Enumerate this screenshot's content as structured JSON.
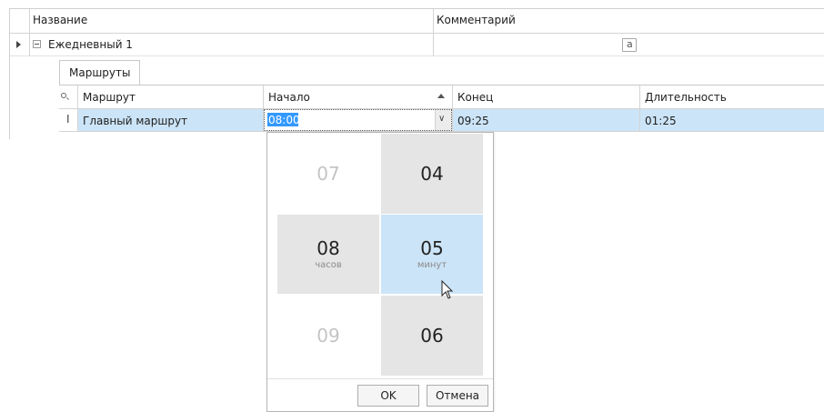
{
  "grid": {
    "columns": {
      "name": "Название",
      "comment": "Комментарий"
    },
    "group_row": {
      "name": "Ежедневный 1",
      "comment_icon": "a"
    }
  },
  "detail": {
    "tab": "Маршруты",
    "columns": {
      "route": "Маршрут",
      "start": "Начало",
      "end": "Конец",
      "duration": "Длительность"
    },
    "row": {
      "route": "Главный маршрут",
      "start": "08:00",
      "end": "09:25",
      "duration": "01:25"
    }
  },
  "time_picker": {
    "hours": {
      "prev": "07",
      "current": "08",
      "next": "09",
      "caption": "часов"
    },
    "minutes": {
      "prev": "04",
      "current": "05",
      "next": "06",
      "caption": "минут"
    },
    "ok_label": "OK",
    "cancel_label": "Отмена"
  },
  "colors": {
    "selection": "#cce4f7",
    "header_bg": "#ffffff",
    "wheel_gray": "#e5e5e5",
    "accent": "#3399ff"
  }
}
